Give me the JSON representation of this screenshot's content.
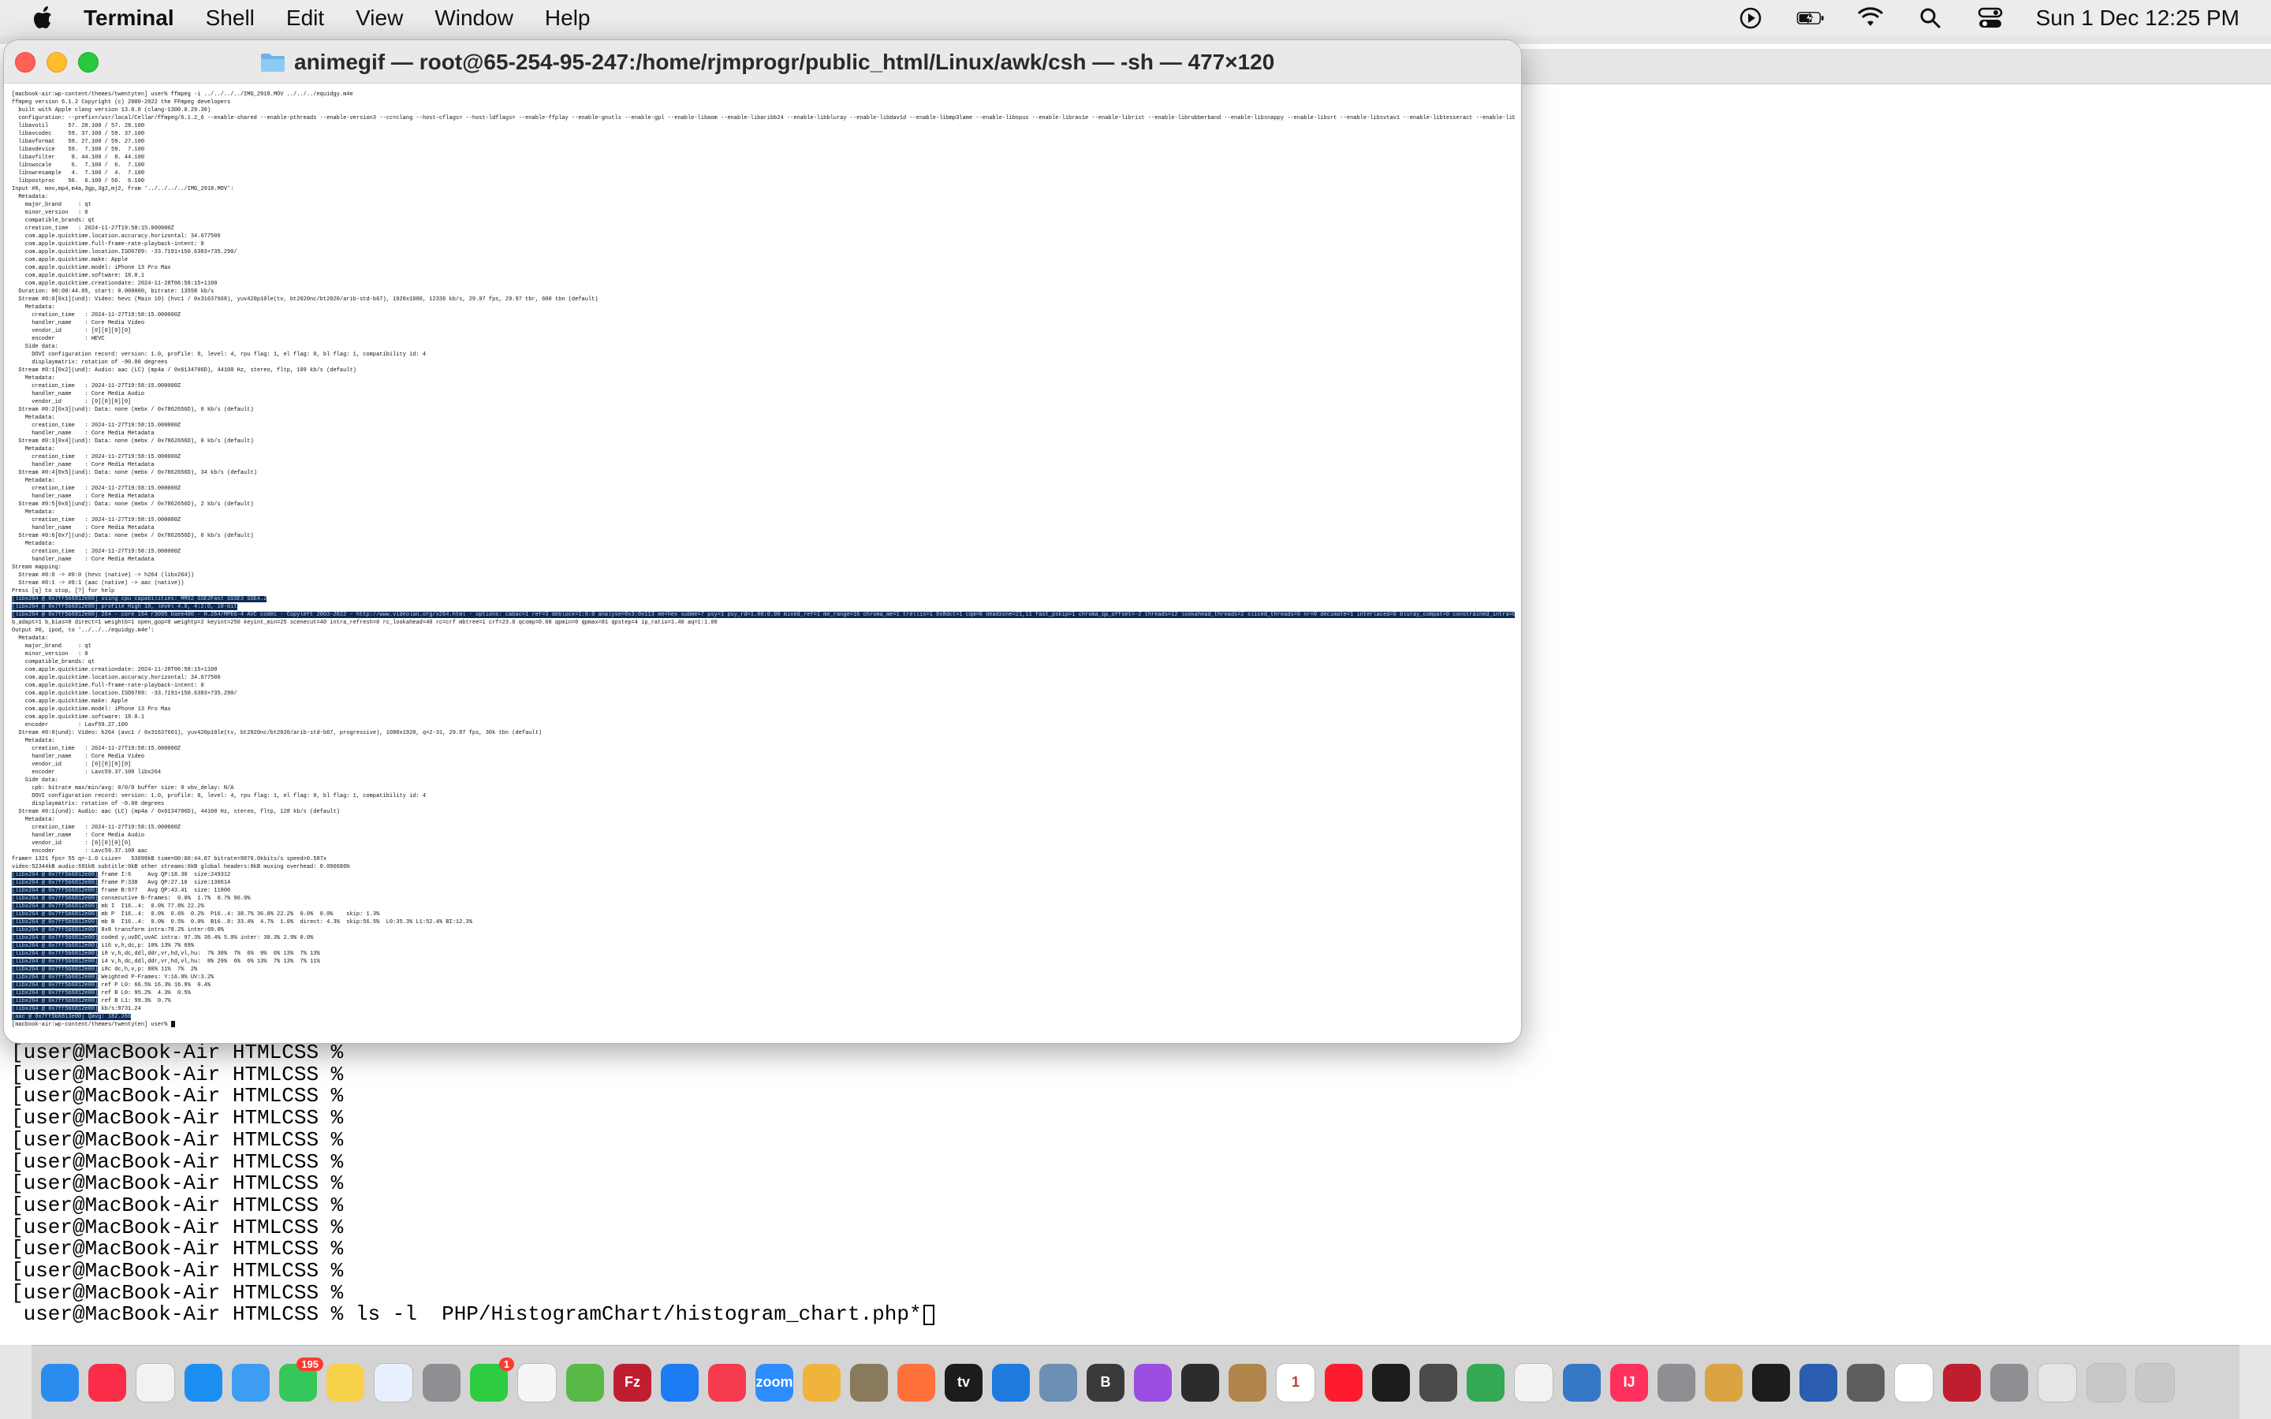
{
  "menubar": {
    "app": "Terminal",
    "items": [
      "Shell",
      "Edit",
      "View",
      "Window",
      "Help"
    ],
    "datetime": "Sun 1 Dec  12:25 PM",
    "icons": [
      "apple-icon",
      "play-icon",
      "battery-icon",
      "wifi-icon",
      "search-icon",
      "control-center-icon"
    ]
  },
  "window": {
    "title": "animegif — root@65-254-95-247:/home/rjmprogr/public_html/Linux/awk/csh — -sh — 477×120",
    "content": "[macbook-air:wp-content/themes/twentyten] user% ffmpeg -i ../../../../IMG_2918.MOV ../../../equidgy.m4e\nffmpeg version 6.1.2 Copyright (c) 2000-2022 the FFmpeg developers\n  built with Apple clang version 13.0.0 (clang-1300.0.29.30)\n  configuration: --prefix=/usr/local/Cellar/ffmpeg/6.1.2_6 --enable-shared --enable-pthreads --enable-version3 --cc=clang --host-cflags= --host-ldflags= --enable-ffplay --enable-gnutls --enable-gpl --enable-libaom --enable-libaribb24 --enable-libbluray --enable-libdav1d --enable-libmp3lame --enable-libopus --enable-librav1e --enable-librist --enable-librubberband --enable-libsnappy --enable-libsrt --enable-libsvtav1 --enable-libtesseract --enable-libtheora --enable-libvidstab --enable-libvmaf --enable-libvorbis --enable-libvpx --enable-libwebp --enable-libx264 --enable-libx265 --enable-libxml2 --enable-libxvid --enable-lzma --enable-libfontconfig --enable-libfreetype --enable-frei0r --enable-libass --enable-libopencore-amrnb --enable-libopencore-amrwb --enable-libopenjpeg --enable-libspeex --enable-libsoxr --enable-libzmq --enable-libzimg --disable-libjack --disable-indev=jack --enable-videotoolbox\n  libavutil      57. 28.100 / 57. 28.100\n  libavcodec     59. 37.100 / 59. 37.100\n  libavformat    59. 27.100 / 59. 27.100\n  libavdevice    59.  7.100 / 59.  7.100\n  libavfilter     8. 44.100 /  8. 44.100\n  libswscale      6.  7.100 /  6.  7.100\n  libswresample   4.  7.100 /  4.  7.100\n  libpostproc    56.  6.100 / 56.  6.100\nInput #0, mov,mp4,m4a,3gp,3g2,mj2, from '../../../../IMG_2918.MOV':\n  Metadata:\n    major_brand     : qt\n    minor_version   : 0\n    compatible_brands: qt\n    creation_time   : 2024-11-27T19:58:15.000000Z\n    com.apple.quicktime.location.accuracy.horizontal: 34.677506\n    com.apple.quicktime.full-frame-rate-playback-intent: 0\n    com.apple.quicktime.location.ISO6709: -33.7191+150.6383+735.290/\n    com.apple.quicktime.make: Apple\n    com.apple.quicktime.model: iPhone 13 Pro Max\n    com.apple.quicktime.software: 18.0.1\n    com.apple.quicktime.creationdate: 2024-11-28T06:58:15+1100\n  Duration: 00:00:44.05, start: 0.000000, bitrate: 13558 kb/s\n  Stream #0:0[0x1](und): Video: hevc (Main 10) (hvc1 / 0x31637668), yuv420p10le(tv, bt2020nc/bt2020/arib-std-b67), 1920x1080, 12336 kb/s, 29.97 fps, 29.97 tbr, 600 tbn (default)\n    Metadata:\n      creation_time   : 2024-11-27T19:58:15.000000Z\n      handler_name    : Core Media Video\n      vendor_id       : [0][0][0][0]\n      encoder         : HEVC\n    Side data:\n      DOVI configuration record: version: 1.0, profile: 8, level: 4, rpu flag: 1, el flag: 0, bl flag: 1, compatibility id: 4\n      displaymatrix: rotation of -90.00 degrees\n  Stream #0:1[0x2](und): Audio: aac (LC) (mp4a / 0x6134706D), 44100 Hz, stereo, fltp, 109 kb/s (default)\n    Metadata:\n      creation_time   : 2024-11-27T19:58:15.000000Z\n      handler_name    : Core Media Audio\n      vendor_id       : [0][0][0][0]\n  Stream #0:2[0x3](und): Data: none (mebx / 0x7862656D), 0 kb/s (default)\n    Metadata:\n      creation_time   : 2024-11-27T19:58:15.000000Z\n      handler_name    : Core Media Metadata\n  Stream #0:3[0x4](und): Data: none (mebx / 0x7862656D), 0 kb/s (default)\n    Metadata:\n      creation_time   : 2024-11-27T19:58:15.000000Z\n      handler_name    : Core Media Metadata\n  Stream #0:4[0x5](und): Data: none (mebx / 0x7862656D), 34 kb/s (default)\n    Metadata:\n      creation_time   : 2024-11-27T19:58:15.000000Z\n      handler_name    : Core Media Metadata\n  Stream #0:5[0x6](und): Data: none (mebx / 0x7862656D), 2 kb/s (default)\n    Metadata:\n      creation_time   : 2024-11-27T19:58:15.000000Z\n      handler_name    : Core Media Metadata\n  Stream #0:6[0x7](und): Data: none (mebx / 0x7862656D), 0 kb/s (default)\n    Metadata:\n      creation_time   : 2024-11-27T19:58:15.000000Z\n      handler_name    : Core Media Metadata\nStream mapping:\n  Stream #0:0 -> #0:0 (hevc (native) -> h264 (libx264))\n  Stream #0:1 -> #0:1 (aac (native) -> aac (native))\nPress [q] to stop, [?] for help",
    "highlight_lines": [
      "[libx264 @ 0x7ff5b6812e00] using cpu capabilities: MMX2 SSE2Fast SSSE3 SSE4.2",
      "[libx264 @ 0x7ff5b6812e00] profile High 10, level 4.0, 4:2:0, 10-bit",
      "[libx264 @ 0x7ff5b6812e00] 264 - core 164 r3095 baee400 - H.264/MPEG-4 AVC codec - Copyleft 2003-2022 - http://www.videolan.org/x264.html - options: cabac=1 ref=3 deblock=1:0:0 analyse=0x3:0x113 me=hex subme=7 psy=1 psy_rd=1.00:0.00 mixed_ref=1 me_range=16 chroma_me=1 trellis=1 8x8dct=1 cqm=0 deadzone=21,11 fast_pskip=1 chroma_qp_offset=-2 threads=12 lookahead_threads=2 sliced_threads=0 nr=0 decimate=1 interlaced=0 bluray_compat=0 constrained_intra=0 bframes=3 b_pyramid=2"
    ],
    "content2": "b_adapt=1 b_bias=0 direct=1 weightb=1 open_gop=0 weightp=2 keyint=250 keyint_min=25 scenecut=40 intra_refresh=0 rc_lookahead=40 rc=crf mbtree=1 crf=23.0 qcomp=0.60 qpmin=0 qpmax=81 qpstep=4 ip_ratio=1.40 aq=1:1.00\nOutput #0, ipod, to '../../../equidgy.m4e':\n  Metadata:\n    major_brand     : qt\n    minor_version   : 0\n    compatible_brands: qt\n    com.apple.quicktime.creationdate: 2024-11-28T06:58:15+1100\n    com.apple.quicktime.location.accuracy.horizontal: 34.677506\n    com.apple.quicktime.full-frame-rate-playback-intent: 0\n    com.apple.quicktime.location.ISO6709: -33.7191+150.6383+735.290/\n    com.apple.quicktime.make: Apple\n    com.apple.quicktime.model: iPhone 13 Pro Max\n    com.apple.quicktime.software: 18.0.1\n    encoder         : Lavf59.27.100\n  Stream #0:0(und): Video: h264 (avc1 / 0x31637661), yuv420p10le(tv, bt2020nc/bt2020/arib-std-b67, progressive), 1080x1920, q=2-31, 29.97 fps, 30k tbn (default)\n    Metadata:\n      creation_time   : 2024-11-27T19:58:15.000000Z\n      handler_name    : Core Media Video\n      vendor_id       : [0][0][0][0]\n      encoder         : Lavc59.37.100 libx264\n    Side data:\n      cpb: bitrate max/min/avg: 0/0/0 buffer size: 0 vbv_delay: N/A\n      DOVI configuration record: version: 1.0, profile: 8, level: 4, rpu flag: 1, el flag: 0, bl flag: 1, compatibility id: 4\n      displaymatrix: rotation of -0.00 degrees\n  Stream #0:1(und): Audio: aac (LC) (mp4a / 0x6134706D), 44100 Hz, stereo, fltp, 128 kb/s (default)\n    Metadata:\n      creation_time   : 2024-11-27T19:58:15.000000Z\n      handler_name    : Core Media Audio\n      vendor_id       : [0][0][0][0]\n      encoder         : Lavc59.37.100 aac\nframe= 1321 fps= 55 q=-1.0 Lsize=   53099kB time=00:00:44.07 bitrate=9870.0kbits/s speed=0.587x\nvideo:52344kB audio:691kB subtitle:0kB other streams:0kB global headers:0kB muxing overhead: 0.096686%",
    "stats_prefix": "[libx264 @ 0x7ff5b6812e00]",
    "stats": [
      "frame I:6     Avg QP:18.30  size:249312",
      "frame P:338   Avg QP:27.10  size:130614",
      "frame B:977   Avg QP:43.41  size: 11006",
      "consecutive B-frames:  0.0%  1.7%  0.7% 96.9%",
      "mb I  I16..4:  0.0% 77.8% 22.2%",
      "mb P  I16..4:  0.0%  0.6%  0.2%  P16..4: 38.7% 36.0% 22.2%  0.0%  0.0%    skip: 1.3%",
      "mb B  I16..4:  0.0%  0.5%  0.0%  B16..8: 33.4%  4.7%  1.0%  direct: 4.3%  skip:56.5%  L0:35.3% L1:52.4% BI:12.3%",
      "8x8 transform intra:78.2% inter:69.0%",
      "coded y,uvDC,uvAC intra: 97.3% 38.4% 5.0% inter: 30.3% 2.9% 0.0%",
      "i16 v,h,dc,p: 10% 13% 7% 69%",
      "i8 v,h,dc,ddl,ddr,vr,hd,vl,hu:  7% 30%  7%  6%  9%  6% 13%  7% 13%",
      "i4 v,h,dc,ddl,ddr,vr,hd,vl,hu:  8% 29%  6%  6% 13%  7% 13%  7% 11%",
      "i8c dc,h,v,p: 80% 11%  7%  2%",
      "Weighted P-Frames: Y:16.9% UV:3.2%",
      "ref P L0: 66.5% 16.3% 16.9%  0.4%",
      "ref B L0: 95.2%  4.3%  0.5%",
      "ref B L1: 99.3%  0.7%",
      "kb/s:9731.24"
    ],
    "aac_line": "[aac @ 0x7ff5b6813e00] Qavg: 182.266",
    "final_prompt": "[macbook-air:wp-content/themes/twentyten] user% "
  },
  "background_terminal": {
    "prompts": [
      "user@MacBook-Air HTMLCSS %",
      "user@MacBook-Air HTMLCSS %",
      "user@MacBook-Air HTMLCSS %",
      "user@MacBook-Air HTMLCSS %",
      "user@MacBook-Air HTMLCSS %",
      "user@MacBook-Air HTMLCSS %",
      "user@MacBook-Air HTMLCSS %",
      "user@MacBook-Air HTMLCSS %",
      "user@MacBook-Air HTMLCSS %",
      "user@MacBook-Air HTMLCSS %",
      "user@MacBook-Air HTMLCSS %",
      "user@MacBook-Air HTMLCSS %"
    ],
    "command_line": "user@MacBook-Air HTMLCSS % ls -l  PHP/HistogramChart/histogram_chart.php*"
  },
  "dock": {
    "items": [
      {
        "name": "finder-icon",
        "color": "#2b8cf0"
      },
      {
        "name": "music-icon",
        "color": "#fa2d48"
      },
      {
        "name": "reminders-icon",
        "color": "#f2f2f2"
      },
      {
        "name": "safari-icon",
        "color": "#1b8ef2"
      },
      {
        "name": "mail-icon",
        "color": "#3d9df2"
      },
      {
        "name": "messages-icon",
        "color": "#35c759",
        "badge": "195"
      },
      {
        "name": "notes-icon",
        "color": "#f7d14a"
      },
      {
        "name": "freeform-icon",
        "color": "#e8f0ff"
      },
      {
        "name": "launchpad-icon",
        "color": "#8e8e93"
      },
      {
        "name": "facetime-icon",
        "color": "#2ecc40",
        "badge": "1"
      },
      {
        "name": "document-icon",
        "color": "#f5f5f5"
      },
      {
        "name": "maps-icon",
        "color": "#58b947"
      },
      {
        "name": "filezilla-icon",
        "color": "#bf1e2e",
        "label": "Fz"
      },
      {
        "name": "app-store-icon",
        "color": "#1b7cf4"
      },
      {
        "name": "news-icon",
        "color": "#f63b4f"
      },
      {
        "name": "zoom-icon",
        "color": "#2d8cff",
        "label": "zoom"
      },
      {
        "name": "photos-icon",
        "color": "#f0b33c"
      },
      {
        "name": "gimp-icon",
        "color": "#8a7a5c"
      },
      {
        "name": "firefox-icon",
        "color": "#ff7139"
      },
      {
        "name": "apple-tv-icon",
        "color": "#1c1c1e",
        "label": "tv"
      },
      {
        "name": "xcode-icon",
        "color": "#1f7ae0"
      },
      {
        "name": "preview-icon",
        "color": "#6d8fb5"
      },
      {
        "name": "bbedit-icon",
        "color": "#3a3a3c",
        "label": "B"
      },
      {
        "name": "podcasts-icon",
        "color": "#9b4ee0"
      },
      {
        "name": "console-icon",
        "color": "#2c2c2e"
      },
      {
        "name": "archive-icon",
        "color": "#b0854c"
      },
      {
        "name": "calendar-icon",
        "color": "#ffffff",
        "label": "1"
      },
      {
        "name": "opera-icon",
        "color": "#ff1b2d"
      },
      {
        "name": "terminal-icon",
        "color": "#1c1c1e"
      },
      {
        "name": "calculator-icon",
        "color": "#4a4a4a"
      },
      {
        "name": "chrome-icon",
        "color": "#34a853"
      },
      {
        "name": "text-file-icon",
        "color": "#f2f2f2"
      },
      {
        "name": "network-icon",
        "color": "#3478c6"
      },
      {
        "name": "intellij-icon",
        "color": "#fe315d",
        "label": "IJ"
      },
      {
        "name": "system-settings-icon",
        "color": "#8e8e93"
      },
      {
        "name": "palette-icon",
        "color": "#d9a441"
      },
      {
        "name": "terminal-2-icon",
        "color": "#1c1c1e"
      },
      {
        "name": "inkscape-icon",
        "color": "#2a5db0"
      },
      {
        "name": "gear-app-icon",
        "color": "#5e5e5e"
      },
      {
        "name": "elephant-icon",
        "color": "#ffffff"
      },
      {
        "name": "filezilla-pro-icon",
        "color": "#bf1e2e"
      },
      {
        "name": "tools-icon",
        "color": "#8e8e93"
      },
      {
        "name": "script-editor-icon",
        "color": "#e5e5e5"
      },
      {
        "name": "downloads-stack-icon",
        "color": "#c8c8c8"
      },
      {
        "name": "trash-icon",
        "color": "#c8c8c8"
      }
    ]
  }
}
